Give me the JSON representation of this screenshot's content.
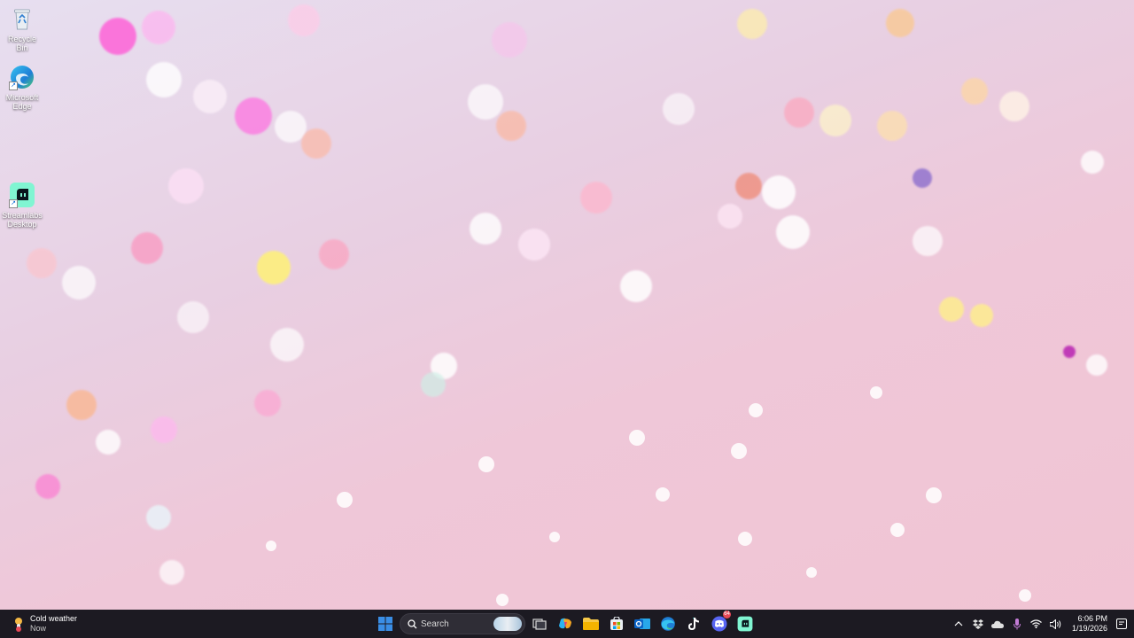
{
  "desktop_icons": [
    {
      "label": "Recycle Bin",
      "icon": "recycle-bin-icon"
    },
    {
      "label": "Microsoft Edge",
      "icon": "edge-icon"
    },
    {
      "label": "Streamlabs Desktop",
      "icon": "streamlabs-icon"
    }
  ],
  "weather": {
    "title": "Cold weather",
    "subtitle": "Now",
    "icon": "weather-sun-icon"
  },
  "search": {
    "label": "Search"
  },
  "taskbar_apps": [
    {
      "name": "start",
      "icon": "windows-start-icon"
    },
    {
      "name": "task-view",
      "icon": "task-view-icon"
    },
    {
      "name": "copilot",
      "icon": "copilot-icon"
    },
    {
      "name": "file-explorer",
      "icon": "folder-icon"
    },
    {
      "name": "microsoft-store",
      "icon": "store-icon"
    },
    {
      "name": "outlook",
      "icon": "outlook-icon"
    },
    {
      "name": "edge",
      "icon": "edge-icon"
    },
    {
      "name": "tiktok",
      "icon": "tiktok-icon"
    },
    {
      "name": "discord",
      "icon": "discord-icon",
      "badge": "64"
    },
    {
      "name": "streamlabs",
      "icon": "streamlabs-icon"
    }
  ],
  "tray": {
    "icons": [
      "chevron-up-icon",
      "dropbox-icon",
      "onedrive-icon",
      "microphone-icon",
      "wifi-icon",
      "speaker-icon"
    ],
    "time": "6:06 PM",
    "date": "1/19/2026"
  },
  "colors": {
    "taskbar_bg": "#1c1a22",
    "accent_blue": "#3a8ee6",
    "streamlabs_green": "#80f5d2",
    "discord_purple": "#5865f2"
  }
}
